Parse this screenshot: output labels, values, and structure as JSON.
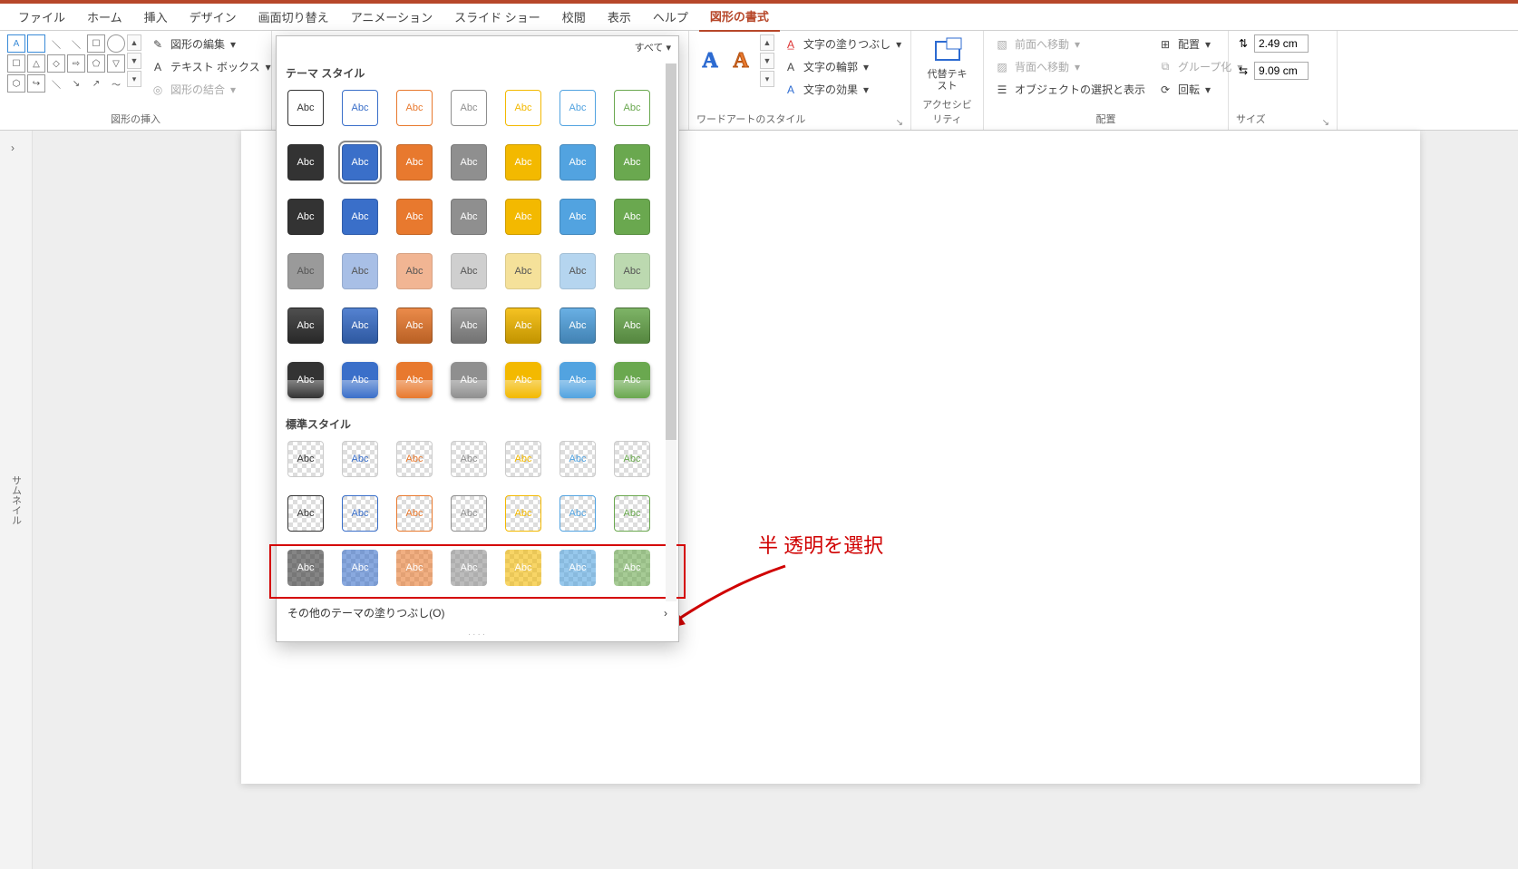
{
  "tabs": {
    "file": "ファイル",
    "home": "ホーム",
    "insert": "挿入",
    "design": "デザイン",
    "transitions": "画面切り替え",
    "animations": "アニメーション",
    "slideshow": "スライド ショー",
    "review": "校閲",
    "view": "表示",
    "help": "ヘルプ",
    "shape_format": "図形の書式"
  },
  "ribbon": {
    "insert_shapes": {
      "label": "図形の挿入",
      "edit_shape": "図形の編集",
      "text_box": "テキスト ボックス",
      "merge_shapes": "図形の結合"
    },
    "wordart": {
      "label": "ワードアートのスタイル",
      "text_fill": "文字の塗りつぶし",
      "text_outline": "文字の輪郭",
      "text_effects": "文字の効果"
    },
    "accessibility": {
      "label": "アクセシビリティ",
      "alt_text": "代替テキスト"
    },
    "arrange": {
      "label": "配置",
      "bring_forward": "前面へ移動",
      "send_backward": "背面へ移動",
      "selection_pane": "オブジェクトの選択と表示",
      "align": "配置",
      "group": "グループ化",
      "rotate": "回転"
    },
    "size": {
      "label": "サイズ",
      "height": "2.49 cm",
      "width": "9.09 cm"
    }
  },
  "thumb_rail": "サムネイル",
  "popup": {
    "filter": "すべて",
    "theme_title": "テーマ スタイル",
    "preset_title": "標準スタイル",
    "sample": "Abc",
    "footer": "その他のテーマの塗りつぶし(O)"
  },
  "annotation": "半 透明を選択",
  "theme_colors": [
    "#333333",
    "#3a6fc9",
    "#e8792e",
    "#8f8f8f",
    "#f3b900",
    "#52a3e0",
    "#6aa84f"
  ],
  "soft_colors": [
    "#9a9a9a",
    "#a8bfe6",
    "#f1b593",
    "#cfcfcf",
    "#f5e19a",
    "#b5d5ef",
    "#bcd9b0"
  ]
}
